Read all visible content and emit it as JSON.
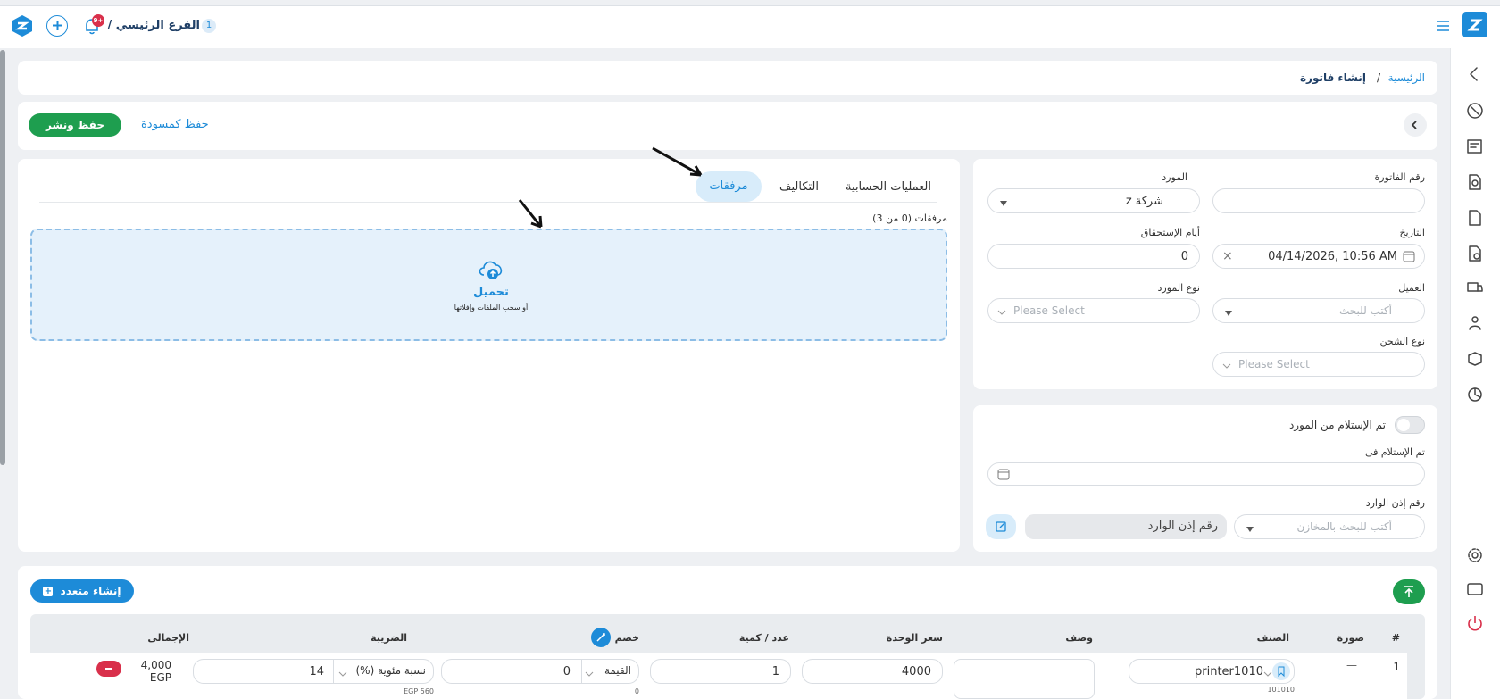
{
  "header": {
    "branch_count": "1",
    "branch_name": "الفرع الرئيسي /",
    "notif_badge": "+9"
  },
  "breadcrumb": {
    "home": "الرئيسية",
    "sep": "/",
    "current": "إنشاء فاتورة"
  },
  "actions": {
    "publish": "حفظ ونشر",
    "draft": "حفظ كمسودة"
  },
  "form": {
    "invoice_number_label": "رقم الفاتورة",
    "supplier_label": "المورد",
    "supplier_value": "شركة z",
    "date_label": "التاريخ",
    "date_value": "04/14/2026, 10:56 AM",
    "due_days_label": "أيام الإستحقاق",
    "due_days_value": "0",
    "client_label": "العميل",
    "client_placeholder": "أكتب للبحث",
    "supplier_type_label": "نوع المورد",
    "supplier_type_placeholder": "Please Select",
    "shipping_type_label": "نوع الشحن",
    "shipping_type_placeholder": "Please Select"
  },
  "receipt": {
    "received_toggle_label": "تم الإستلام من المورد",
    "received_at_label": "تم الإستلام فى",
    "inbound_number_label": "رقم إذن الوارد",
    "warehouse_placeholder": "أكتب للبحث بالمخازن",
    "inbound_placeholder": "رقم إذن الوارد"
  },
  "tabs": {
    "accounting": "العمليات الحسابية",
    "costs": "التكاليف",
    "attachments": "مرفقات"
  },
  "attachments": {
    "count_label": "مرفقات (0 من 3)",
    "upload_title": "تحميل",
    "upload_hint": "أو سحب الملفات وإفلاتها"
  },
  "items": {
    "create_multiple": "إنشاء متعدد",
    "columns": {
      "num": "#",
      "image": "صورة",
      "item": "الصنف",
      "description": "وصف",
      "unit_price": "سعر الوحدة",
      "quantity": "عدد / كمية",
      "discount": "خصم",
      "tax": "الضريبة",
      "total": "الإجمالى"
    },
    "rows": [
      {
        "num": "1",
        "image": "—",
        "item": "printer1010",
        "item_code": "101010",
        "unit_price": "4000",
        "quantity": "1",
        "discount_type": "القيمة",
        "discount_value": "0",
        "discount_sub": "0",
        "tax_type": "نسبة مئوية (%)",
        "tax_value": "14",
        "tax_sub": "EGP 560",
        "total_amount": "4,000",
        "total_currency": "EGP"
      }
    ]
  },
  "colors": {
    "primary": "#1d8bd8",
    "success": "#1e9e4f",
    "danger": "#d9304b",
    "accent_light": "#d8ecfa"
  }
}
